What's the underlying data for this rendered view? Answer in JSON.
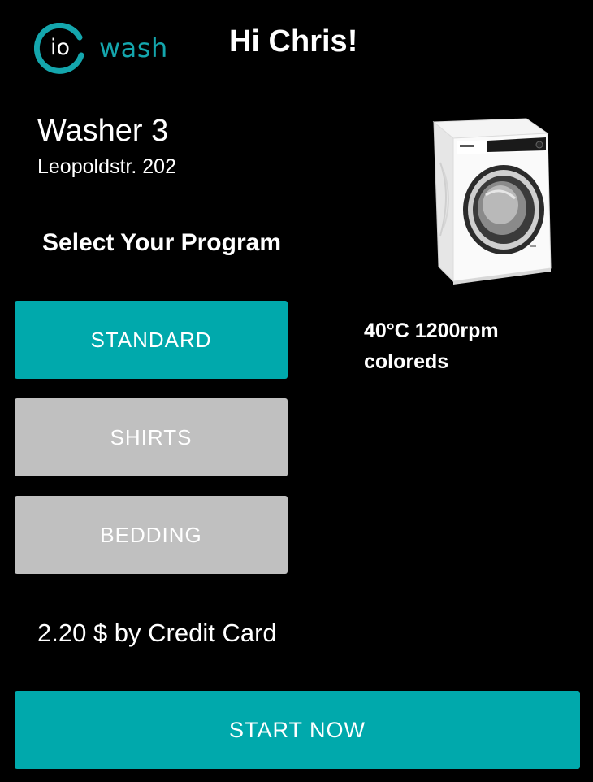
{
  "brand": {
    "logo_prefix": "io",
    "logo_name": "wash",
    "accent_color": "#14a6ad"
  },
  "header": {
    "greeting": "Hi Chris!"
  },
  "machine": {
    "name": "Washer 3",
    "address": "Leopoldstr. 202",
    "image_icon": "washing-machine-image"
  },
  "programs": {
    "title": "Select Your Program",
    "items": [
      {
        "label": "STANDARD",
        "selected": true,
        "color": "#00a9ac"
      },
      {
        "label": "SHIRTS",
        "selected": false,
        "color": "#c0c0c0"
      },
      {
        "label": "BEDDING",
        "selected": false,
        "color": "#c0c0c0"
      }
    ],
    "selected_details": {
      "line1": "40°C 1200rpm",
      "line2": "coloreds"
    }
  },
  "payment": {
    "price_text": "2.20 $ by Credit Card"
  },
  "actions": {
    "start_label": "START NOW",
    "start_color": "#00a9ac"
  }
}
